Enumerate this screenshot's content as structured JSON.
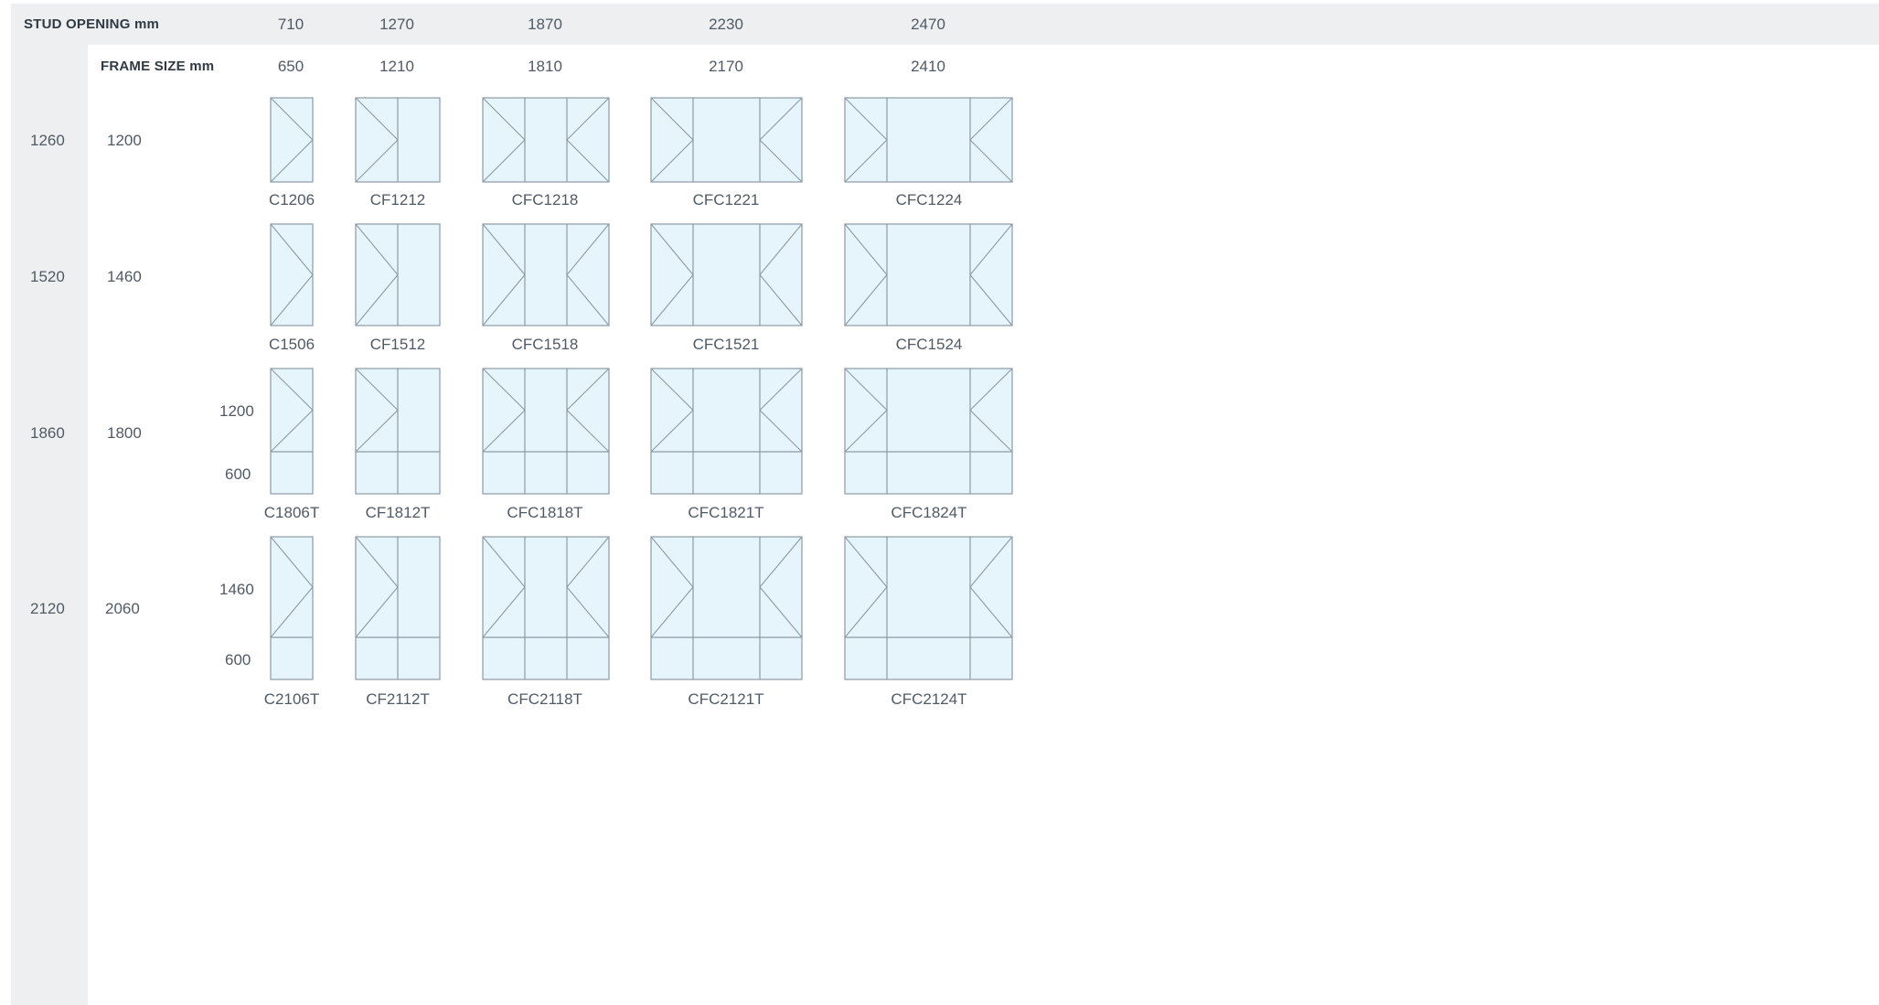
{
  "header": {
    "stud_label": "STUD OPENING mm",
    "frame_label": "FRAME SIZE mm"
  },
  "columns": [
    {
      "stud": "710",
      "frame": "650",
      "panes": [
        "hinged"
      ]
    },
    {
      "stud": "1270",
      "frame": "1210",
      "panes": [
        "hinged",
        "fixed"
      ]
    },
    {
      "stud": "1870",
      "frame": "1810",
      "panes": [
        "hinged",
        "fixed",
        "hinged-right"
      ]
    },
    {
      "stud": "2230",
      "frame": "2170",
      "panes": [
        "hinged",
        "fixed",
        "hinged-right"
      ]
    },
    {
      "stud": "2470",
      "frame": "2410",
      "panes": [
        "hinged",
        "fixed",
        "hinged-right"
      ]
    }
  ],
  "rows": [
    {
      "stud": "1260",
      "frame": "1200",
      "transom": false,
      "upper_label": "",
      "lower_label": "",
      "codes": [
        "C1206",
        "CF1212",
        "CFC1218",
        "CFC1221",
        "CFC1224"
      ]
    },
    {
      "stud": "1520",
      "frame": "1460",
      "transom": false,
      "upper_label": "",
      "lower_label": "",
      "codes": [
        "C1506",
        "CF1512",
        "CFC1518",
        "CFC1521",
        "CFC1524"
      ]
    },
    {
      "stud": "1860",
      "frame": "1800",
      "transom": true,
      "upper_label": "1200",
      "lower_label": "600",
      "codes": [
        "C1806T",
        "CF1812T",
        "CFC1818T",
        "CFC1821T",
        "CFC1824T"
      ]
    },
    {
      "stud": "2120",
      "frame": "2060",
      "transom": true,
      "upper_label": "1460",
      "lower_label": "600",
      "codes": [
        "C2106T",
        "CF2112T",
        "CFC2118T",
        "CFC2121T",
        "CFC2124T"
      ]
    }
  ],
  "colors": {
    "band": "#eeeff1",
    "glass": "#e6f4fb",
    "frame_line": "#8c9aa5"
  }
}
